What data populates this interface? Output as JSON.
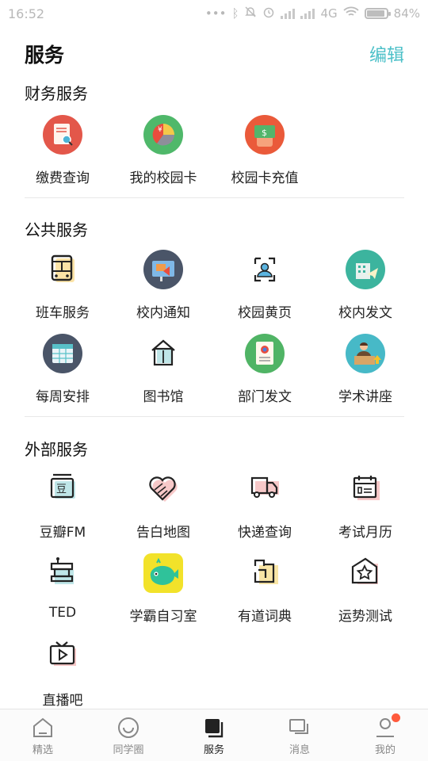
{
  "status_bar": {
    "time": "16:52",
    "network": "4G",
    "battery": "84%"
  },
  "header": {
    "title": "服务",
    "edit_label": "编辑"
  },
  "sections": [
    {
      "title": "财务服务",
      "items": [
        {
          "label": "缴费查询",
          "icon": "receipt-search-icon"
        },
        {
          "label": "我的校园卡",
          "icon": "campus-card-icon"
        },
        {
          "label": "校园卡充值",
          "icon": "card-recharge-icon"
        }
      ]
    },
    {
      "title": "公共服务",
      "items": [
        {
          "label": "班车服务",
          "icon": "bus-icon"
        },
        {
          "label": "校内通知",
          "icon": "notice-icon"
        },
        {
          "label": "校园黄页",
          "icon": "contacts-icon"
        },
        {
          "label": "校内发文",
          "icon": "send-document-icon"
        },
        {
          "label": "每周安排",
          "icon": "calendar-icon"
        },
        {
          "label": "图书馆",
          "icon": "library-icon"
        },
        {
          "label": "部门发文",
          "icon": "department-document-icon"
        },
        {
          "label": "学术讲座",
          "icon": "lecture-icon"
        }
      ]
    },
    {
      "title": "外部服务",
      "items": [
        {
          "label": "豆瓣FM",
          "icon": "radio-icon"
        },
        {
          "label": "告白地图",
          "icon": "heart-map-icon"
        },
        {
          "label": "快递查询",
          "icon": "delivery-truck-icon"
        },
        {
          "label": "考试月历",
          "icon": "exam-calendar-icon"
        },
        {
          "label": "TED",
          "icon": "podium-icon"
        },
        {
          "label": "学霸自习室",
          "icon": "whale-study-room-icon"
        },
        {
          "label": "有道词典",
          "icon": "dictionary-icon"
        },
        {
          "label": "运势测试",
          "icon": "fortune-star-icon"
        },
        {
          "label": "直播吧",
          "icon": "live-tv-icon"
        }
      ]
    }
  ],
  "tabbar": {
    "active": "服务",
    "tabs": [
      {
        "label": "精选",
        "icon": "home-icon"
      },
      {
        "label": "同学圈",
        "icon": "smile-icon"
      },
      {
        "label": "服务",
        "icon": "service-icon"
      },
      {
        "label": "消息",
        "icon": "message-icon"
      },
      {
        "label": "我的",
        "icon": "profile-icon",
        "has_badge": true
      }
    ]
  },
  "colors": {
    "accent": "#4cc0c8",
    "badge": "#ff5a3c",
    "shadow_red": "#f7c8c8",
    "shadow_teal": "#bfe6e8",
    "shadow_yellow": "#f9e6a6"
  }
}
